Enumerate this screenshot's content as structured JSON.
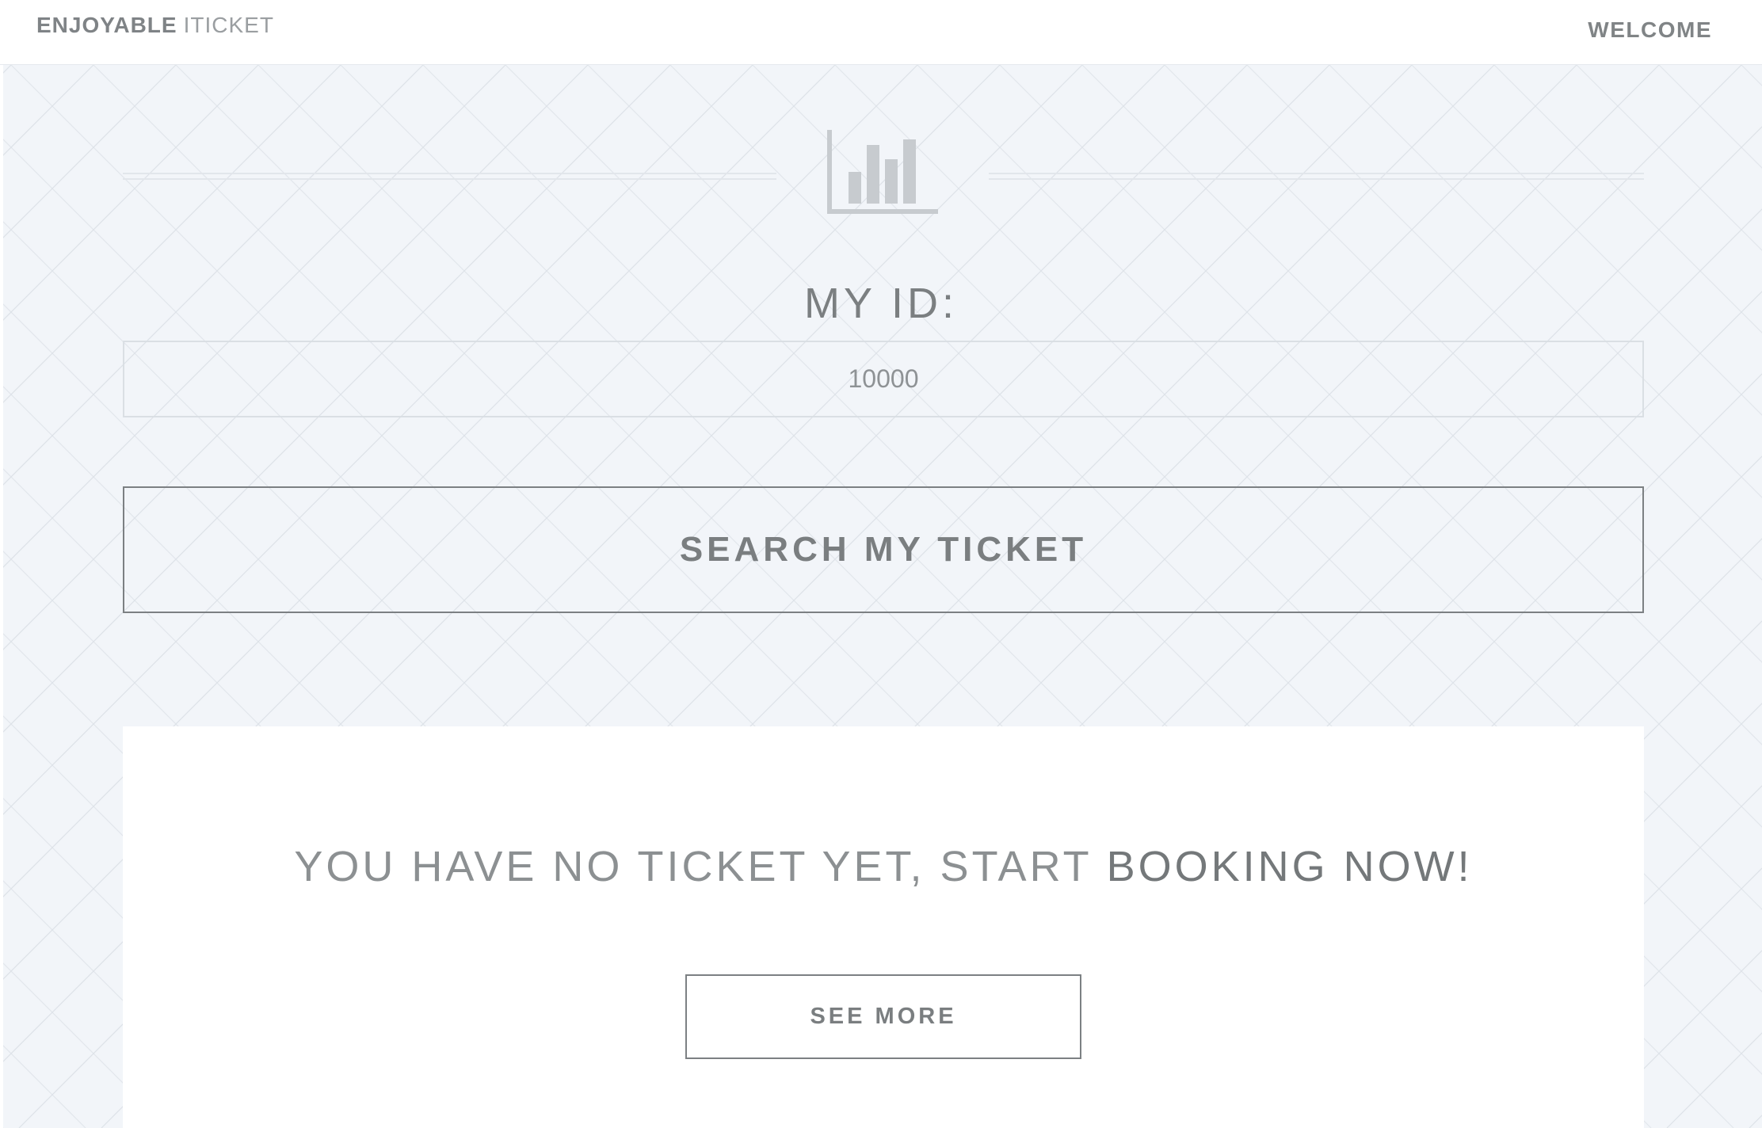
{
  "header": {
    "brand_bold": "ENJOYABLE",
    "brand_light": "ITICKET",
    "welcome_label": "WELCOME"
  },
  "main": {
    "icon": "bar-chart-icon",
    "id_label": "MY ID:",
    "id_input": {
      "value": "",
      "placeholder": "10000"
    },
    "search_button_label": "SEARCH MY TICKET"
  },
  "ticket_card": {
    "message_prefix": "YOU HAVE NO TICKET YET, START ",
    "message_emphasis": "BOOKING NOW!",
    "see_more_label": "SEE MORE"
  },
  "colors": {
    "background": "#f2f5f9",
    "text": "#7b7f81",
    "border": "#7c8083",
    "card": "#ffffff"
  }
}
